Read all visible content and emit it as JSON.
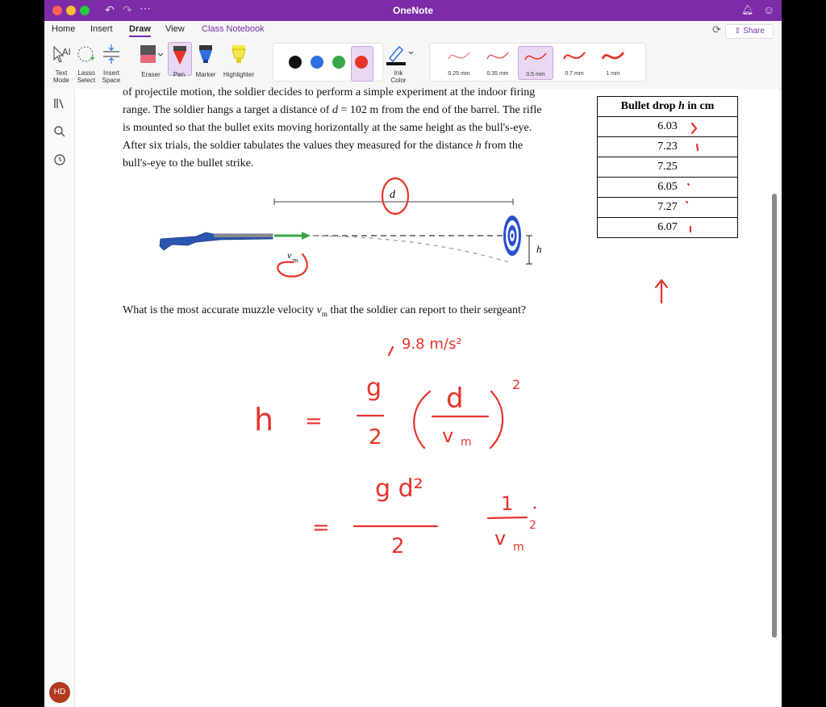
{
  "app": {
    "title": "OneNote"
  },
  "tabs": [
    "Home",
    "Insert",
    "Draw",
    "View",
    "Class Notebook"
  ],
  "share_label": "Share",
  "ribbon": {
    "tools": [
      "Text\nMode",
      "Lasso\nSelect",
      "Insert\nSpace"
    ],
    "pens": [
      "Eraser",
      "Pen",
      "Marker",
      "Highlighter"
    ],
    "ink_color_label": "Ink\nColor",
    "colors": [
      "#111111",
      "#2f6fe0",
      "#3aa64a",
      "#e8332a"
    ],
    "thickness": [
      "0.25 mm",
      "0.35 mm",
      "0.5 mm",
      "0.7 mm",
      "1 mm"
    ],
    "selected_thickness": "0.5 mm"
  },
  "user_initials": "HD",
  "problem": {
    "text_line1": "of projectile motion, the soldier decides to perform a simple experiment at the indoor firing",
    "text_line2a": "range. The soldier hangs a target a distance of ",
    "d_symbol": "d",
    "text_line2b": " = 102 m from the end of the barrel. The rifle",
    "text_line3": "is mounted so that the bullet exits moving horizontally at the same height as the bull's-eye.",
    "text_line4a": "After six trials, the soldier tabulates the values they measured for the distance ",
    "h_symbol": "h",
    "text_line4b": " from the",
    "text_line5": "bull's-eye to the bullet strike.",
    "question_a": "What is the most accurate muzzle velocity ",
    "vm_symbol": "v",
    "vm_sub": "m",
    "question_b": " that the soldier can report to their sergeant?"
  },
  "figure": {
    "d_label": "d",
    "h_label": "h",
    "v_label": "v",
    "v_sub": "m"
  },
  "table": {
    "header_a": "Bullet drop ",
    "header_h": "h",
    "header_b": " in cm",
    "rows": [
      "6.03",
      "7.23",
      "7.25",
      "6.05",
      "7.27",
      "6.07"
    ]
  },
  "ink": {
    "g_value": "9.8 m/s²",
    "eq1_left": "h",
    "eq_sign": "=",
    "g": "g",
    "two": "2",
    "d": "d",
    "vm": "v",
    "vm_sub": "m",
    "sq": "2",
    "gd2": "g d²",
    "one": "1"
  }
}
